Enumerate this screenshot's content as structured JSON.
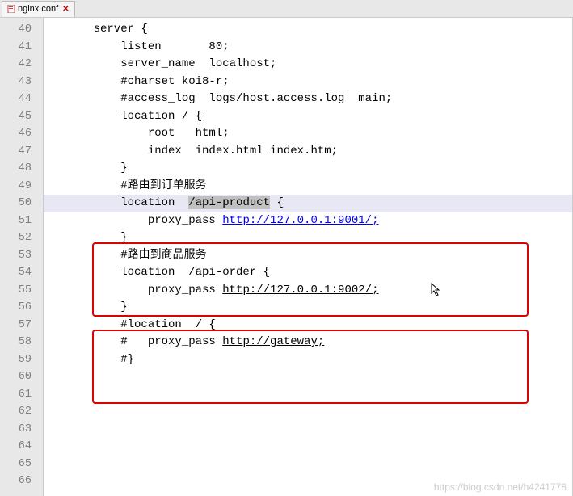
{
  "tab": {
    "filename": "nginx.conf"
  },
  "lines": {
    "start": 40,
    "end": 66,
    "content": {
      "40": "    server {",
      "41": "        listen       80;",
      "42": "        server_name  localhost;",
      "43": "",
      "44": "        #charset koi8-r;",
      "45": "",
      "46": "        #access_log  logs/host.access.log  main;",
      "47": "",
      "48": "        location / {",
      "49": "            root   html;",
      "50": "            index  index.html index.htm;",
      "51": "        }",
      "52": "",
      "53": "        #路由到订单服务",
      "54_pre": "        location  ",
      "54_sel": "/api-product",
      "54_post": " {",
      "55_pre": "            proxy_pass ",
      "55_link": "http://127.0.0.1:9001/;",
      "56": "        }",
      "57": "",
      "58": "        #路由到商品服务",
      "59": "        location  /api-order {",
      "60_pre": "            proxy_pass ",
      "60_link": "http://127.0.0.1:9002/;",
      "61": "        }",
      "62": "",
      "63": "        #location  / {",
      "64_pre": "        #   proxy_pass ",
      "64_link": "http://gateway;",
      "65": "        #}",
      "66": ""
    }
  },
  "watermark": "https://blog.csdn.net/h4241778"
}
